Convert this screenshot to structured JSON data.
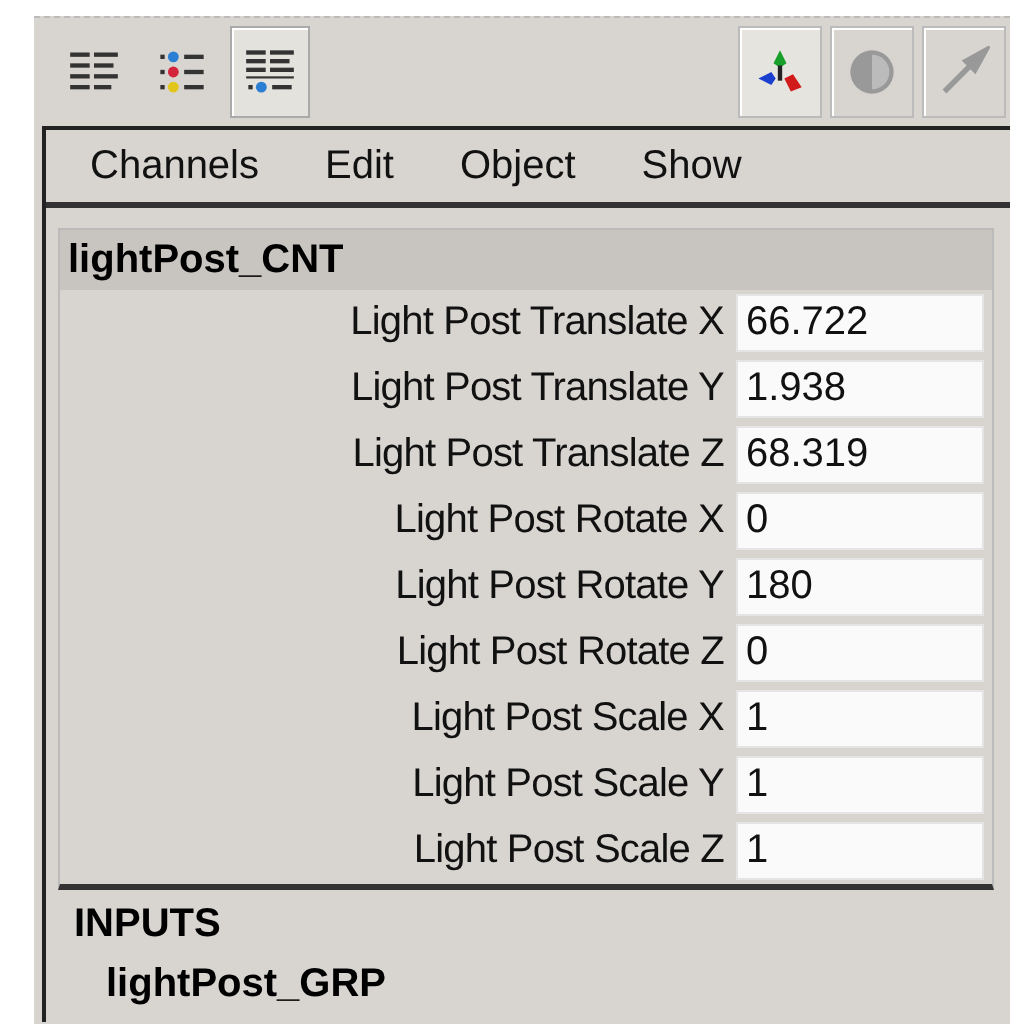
{
  "toolbar": {
    "mode_buttons": [
      {
        "kind": "list",
        "selected": false
      },
      {
        "kind": "dots",
        "selected": false
      },
      {
        "kind": "combo",
        "selected": true
      }
    ],
    "tool_buttons": [
      {
        "kind": "axes",
        "disabled": false
      },
      {
        "kind": "disc",
        "disabled": true
      },
      {
        "kind": "arrow",
        "disabled": true
      }
    ]
  },
  "menu": [
    "Channels",
    "Edit",
    "Object",
    "Show"
  ],
  "object": {
    "name": "lightPost_CNT",
    "channels": [
      {
        "label": "Light Post Translate X",
        "value": "66.722"
      },
      {
        "label": "Light Post Translate Y",
        "value": "1.938"
      },
      {
        "label": "Light Post Translate Z",
        "value": "68.319"
      },
      {
        "label": "Light Post Rotate X",
        "value": "0"
      },
      {
        "label": "Light Post Rotate Y",
        "value": "180"
      },
      {
        "label": "Light Post Rotate Z",
        "value": "0"
      },
      {
        "label": "Light Post Scale X",
        "value": "1"
      },
      {
        "label": "Light Post Scale Y",
        "value": "1"
      },
      {
        "label": "Light Post Scale Z",
        "value": "1"
      }
    ]
  },
  "inputs": {
    "heading": "INPUTS",
    "items": [
      "lightPost_GRP"
    ]
  }
}
